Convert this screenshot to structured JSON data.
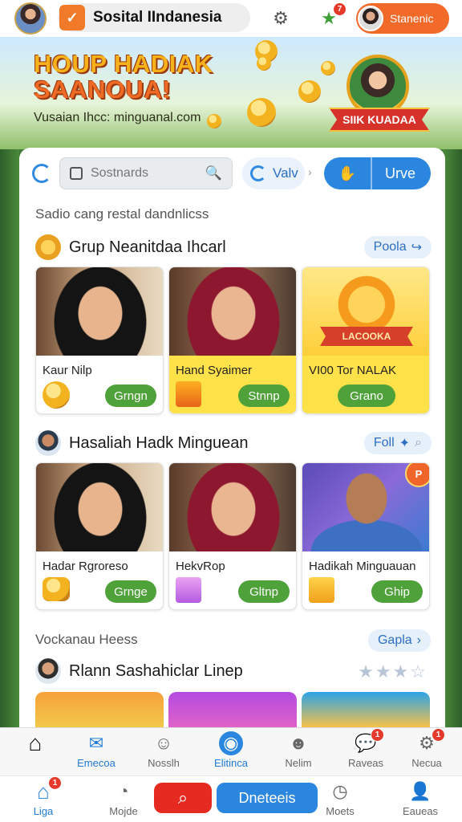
{
  "topbar": {
    "brand_name": "Sosital IIndanesia",
    "notification_count": "7",
    "user_name": "Stanenic"
  },
  "banner": {
    "title_line1": "HOUP HADIAK",
    "title_line2": "SAANOUA!",
    "subtitle": "Vusaian Ihcc: minguanal.com",
    "ribbon": "SIIK KUADAA"
  },
  "search": {
    "placeholder": "Sostnards",
    "valv_label": "Valv",
    "urve_label": "Urve"
  },
  "caption_top": "Sadio cang restal dandnlicss",
  "sections": [
    {
      "title": "Grup Neanitdaa Ihcarl",
      "pill": "Poola",
      "cards": [
        {
          "label": "Kaur Nilp",
          "action": "Grngn"
        },
        {
          "label": "Hand Syaimer",
          "action": "Stnnp"
        },
        {
          "label": "VI00 Tor NALAK",
          "action": "Grano",
          "badge_text": "LACOOKA"
        }
      ]
    },
    {
      "title": "Hasaliah Hadk Minguean",
      "pill": "Foll",
      "cards": [
        {
          "label": "Hadar Rgroreso",
          "action": "Grnge"
        },
        {
          "label": "HekvRop",
          "action": "Gltnp"
        },
        {
          "label": "Hadikah Minguauan",
          "action": "Ghip",
          "tag": "P"
        }
      ]
    }
  ],
  "caption_mid": "Vockanau Heess",
  "caption_mid_pill": "Gapla",
  "section3_title": "Rlann Sashahiclar Linep",
  "nav_top": [
    {
      "label": "",
      "icon": "home-icon"
    },
    {
      "label": "Emecoa",
      "icon": "mail-icon"
    },
    {
      "label": "Nosslh",
      "icon": "profile-icon"
    },
    {
      "label": "Elitinca",
      "icon": "globe-icon"
    },
    {
      "label": "Nelim",
      "icon": "face-icon"
    },
    {
      "label": "Raveas",
      "icon": "chat-icon",
      "badge": "1"
    },
    {
      "label": "Necua",
      "icon": "gear-icon",
      "badge": "1"
    }
  ],
  "nav_bottom": {
    "home_label": "Liga",
    "home_badge": "1",
    "mojde_label": "Mojde",
    "blue_pill": "Dneteeis",
    "moets_label": "Moets",
    "eaueas_label": "Eaueas"
  },
  "colors": {
    "brand_orange": "#f07a2a",
    "primary_blue": "#2b86df",
    "action_green": "#4fa13a",
    "alert_red": "#e52a22"
  }
}
